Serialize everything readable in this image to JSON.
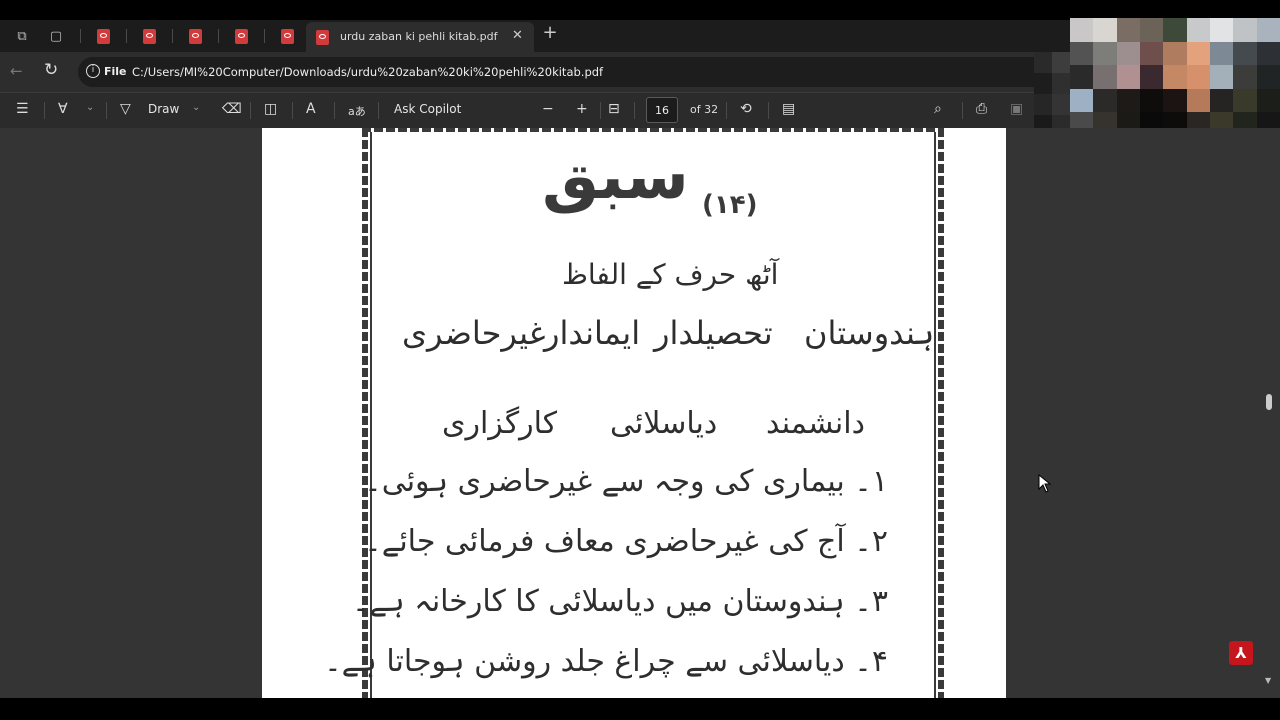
{
  "browser": {
    "tabs": {
      "active_title": "urdu zaban ki pehli kitab.pdf",
      "new_tab_label": "+"
    },
    "address": {
      "scheme_label": "File",
      "url": "C:/Users/MI%20Computer/Downloads/urdu%20zaban%20ki%20pehli%20kitab.pdf"
    }
  },
  "pdf_toolbar": {
    "draw_label": "Draw",
    "ask_copilot_label": "Ask Copilot",
    "zoom_out_symbol": "−",
    "zoom_in_symbol": "+",
    "page_current": "16",
    "page_total": "of 32"
  },
  "page": {
    "lesson_word": "سبق",
    "lesson_number": "(۱۴)",
    "subtitle": "آٹھ حرف کے الفاظ",
    "words_row1": [
      "ہندوستان",
      "تحصیلدار",
      "ایماندار",
      "غیرحاضری"
    ],
    "words_row2": [
      "دانشمند",
      "دیاسلائی",
      "کارگزاری"
    ],
    "sentences": [
      "۱۔ بیماری کی وجہ سے غیرحاضری ہوئی۔",
      "۲۔ آج کی غیرحاضری معاف فرمائی جائے۔",
      "۳۔ ہندوستان میں دیاسلائی کا کارخانہ ہے۔",
      "۴۔ دیاسلائی سے چراغ جلد روشن ہوجاتا ہے۔"
    ]
  },
  "icons": {
    "adobe": "adobe-acrobat-icon"
  }
}
